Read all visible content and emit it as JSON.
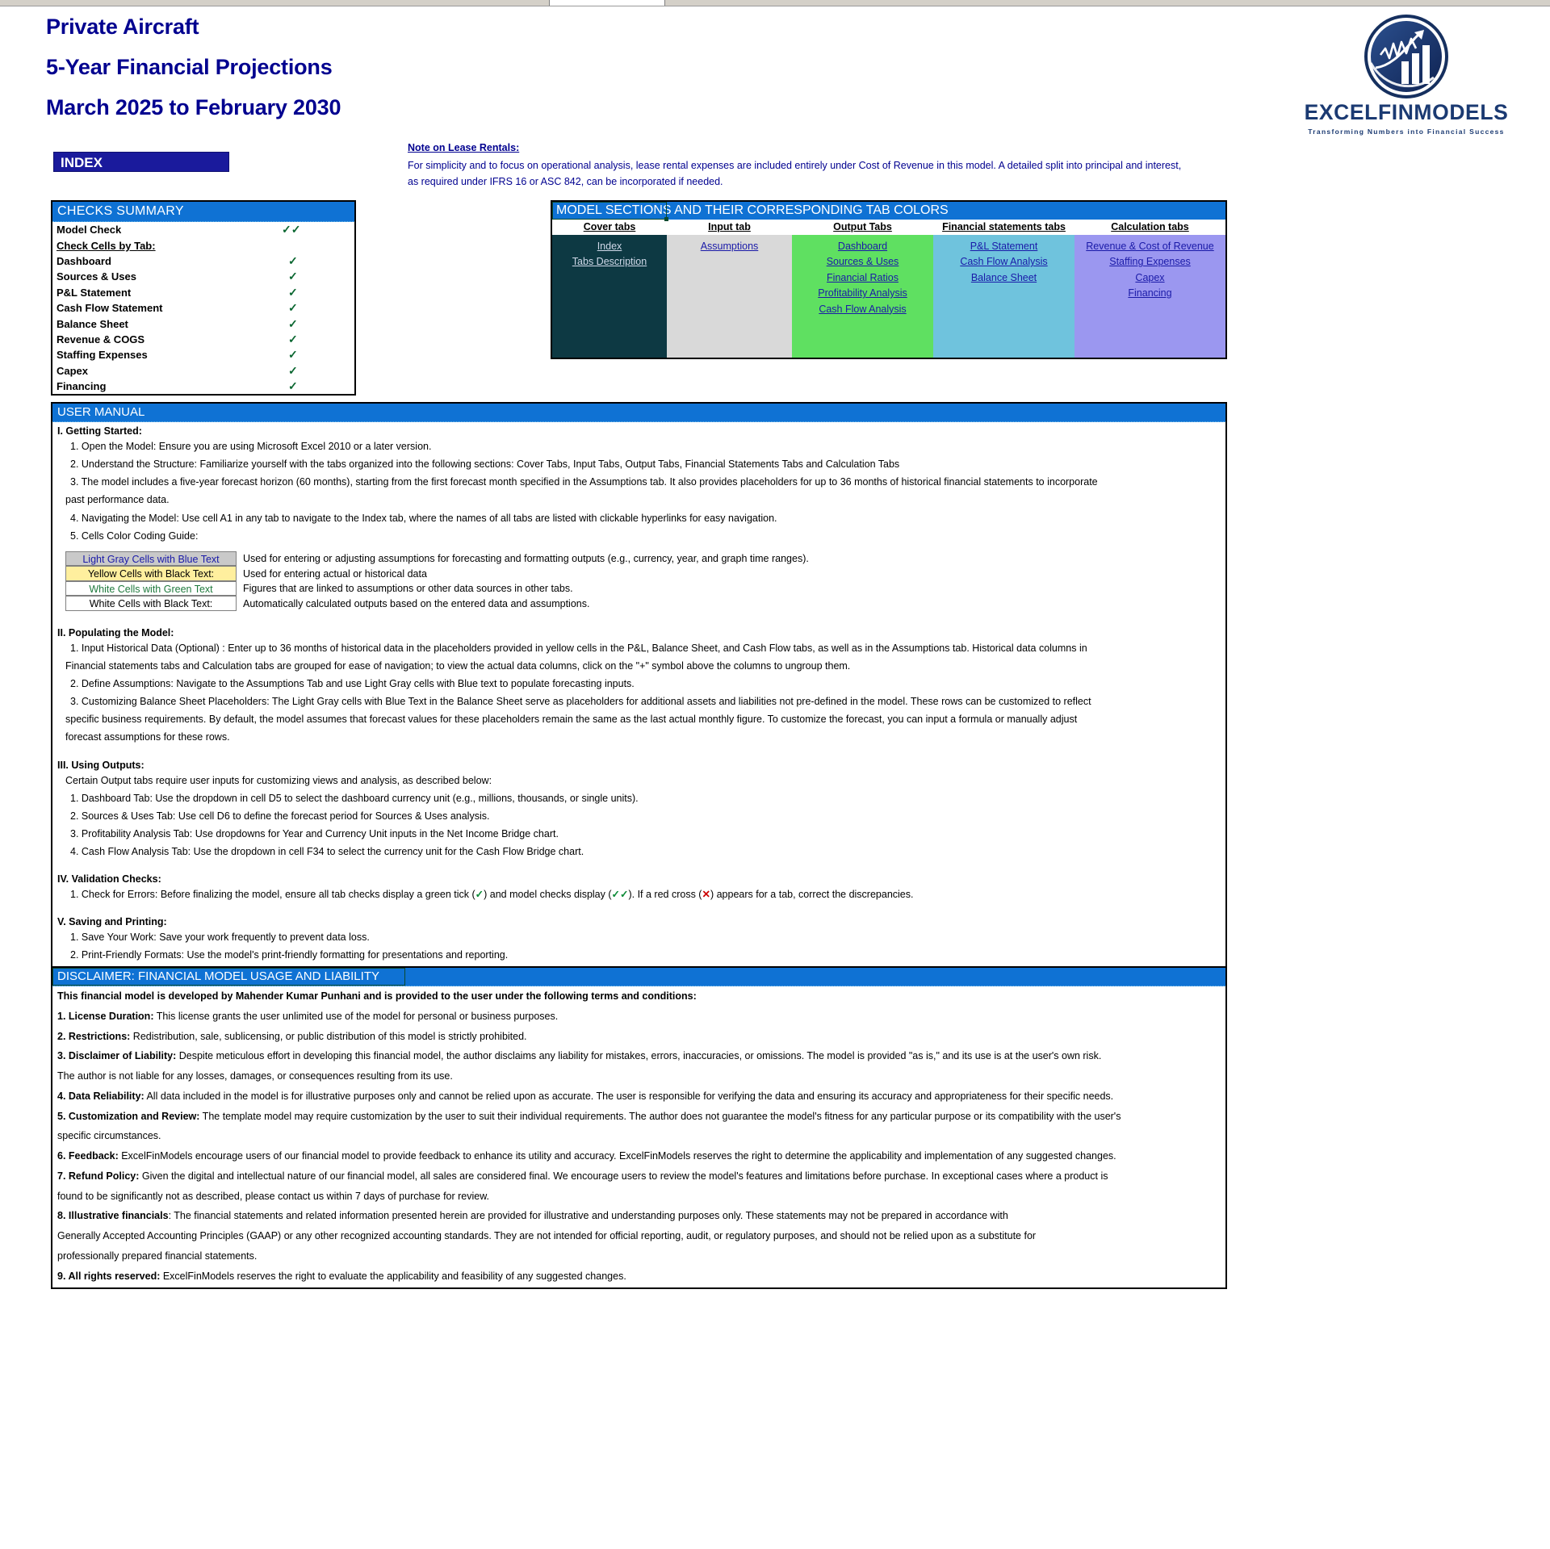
{
  "workbook": {
    "title_lines": [
      "Private Aircraft",
      "5-Year Financial Projections",
      "March 2025 to February 2030"
    ],
    "index_banner": "INDEX"
  },
  "logo": {
    "name": "EXCELFINMODELS",
    "tagline": "Transforming Numbers into Financial Success",
    "mark_icon": "chart-growth-circle-logo",
    "brand_color": "#1b3a72"
  },
  "lease_note": {
    "heading": "Note on Lease Rentals:",
    "body_line_1": "For simplicity and to focus on operational analysis, lease rental expenses are included entirely under Cost of Revenue in this model. A detailed split into principal and interest,",
    "body_line_2": "as required under IFRS 16 or ASC 842, can be incorporated if needed."
  },
  "checks_summary": {
    "header": "CHECKS  SUMMARY",
    "model_check": {
      "label": "Model Check",
      "mark": "✓✓"
    },
    "subhead": "Check Cells by Tab:",
    "rows": [
      {
        "label": "Dashboard",
        "mark": "✓"
      },
      {
        "label": "Sources & Uses",
        "mark": "✓"
      },
      {
        "label": "P&L Statement",
        "mark": "✓"
      },
      {
        "label": "Cash Flow Statement",
        "mark": "✓"
      },
      {
        "label": "Balance Sheet",
        "mark": "✓"
      },
      {
        "label": "Revenue & COGS",
        "mark": "✓"
      },
      {
        "label": "Staffing Expenses",
        "mark": "✓"
      },
      {
        "label": "Capex",
        "mark": "✓"
      },
      {
        "label": "Financing",
        "mark": "✓"
      }
    ]
  },
  "model_sections": {
    "header": "MODEL SECTIONS AND THEIR CORRESPONDING TAB COLORS",
    "columns": [
      {
        "header": "Cover tabs",
        "color": "#0d3943",
        "links": [
          "Index",
          "Tabs Description"
        ]
      },
      {
        "header": "Input tab",
        "color": "#d9d9d9",
        "links": [
          "Assumptions "
        ]
      },
      {
        "header": "Output Tabs",
        "color": "#5fe061",
        "links": [
          "Dashboard",
          "Sources & Uses",
          "Financial Ratios ",
          "Profitability Analysis",
          "Cash Flow Analysis"
        ]
      },
      {
        "header": "Financial statements tabs",
        "color": "#6fc3dd",
        "links": [
          "P&L Statement",
          "Cash Flow Analysis",
          "Balance Sheet"
        ]
      },
      {
        "header": "Calculation tabs",
        "color": "#9b97f0",
        "links": [
          "Revenue & Cost of Revenue",
          "Staffing Expenses",
          "Capex ",
          "Financing"
        ]
      }
    ]
  },
  "user_manual": {
    "header": "USER MANUAL",
    "section_1_title": "I. Getting Started:",
    "section_1_items": [
      "1. Open the Model: Ensure you are using Microsoft Excel 2010 or a later version.",
      "2. Understand the Structure: Familiarize yourself with the tabs organized into the following sections: Cover Tabs, Input Tabs, Output Tabs, Financial Statements Tabs and Calculation Tabs",
      "3. The model includes a five-year forecast horizon (60 months), starting from the first forecast month specified in the Assumptions tab. It also provides placeholders for up to 36 months of historical financial statements to incorporate",
      "past performance data.",
      "4. Navigating the Model: Use cell A1 in any tab to navigate to the Index tab, where the names of all tabs are listed with clickable hyperlinks for easy navigation.",
      "5. Cells Color Coding Guide:"
    ],
    "legend": [
      {
        "swatch": "Light Gray Cells with Blue Text",
        "desc": "Used for entering or adjusting assumptions for forecasting and formatting outputs (e.g., currency, year, and graph time ranges)."
      },
      {
        "swatch": "Yellow Cells with Black Text:",
        "desc": "Used for entering actual or historical data"
      },
      {
        "swatch": "White Cells with Green Text",
        "desc": "Figures that are linked to assumptions or other data sources in other tabs."
      },
      {
        "swatch": "White Cells with Black Text:",
        "desc": "Automatically calculated outputs based on the entered data and assumptions."
      }
    ],
    "section_2_title": "II. Populating the Model:",
    "section_2_items": [
      "1. Input Historical Data (Optional) : Enter up to 36 months of historical data in the placeholders provided in yellow cells in the P&L, Balance Sheet, and Cash Flow tabs, as well as in the Assumptions tab. Historical data columns in",
      "Financial statements tabs and Calculation tabs are grouped for ease of navigation; to view the actual data columns, click on the \"+\" symbol above the columns to ungroup them.",
      "2. Define Assumptions: Navigate to the Assumptions Tab and use Light Gray cells with Blue text to populate forecasting inputs.",
      "3. Customizing Balance Sheet Placeholders: The Light Gray cells with Blue Text in the Balance Sheet serve as placeholders for additional assets and liabilities not pre-defined in the model. These rows can be customized to reflect",
      "specific business requirements. By default, the model assumes that forecast values for these placeholders remain the same as the last actual monthly figure. To customize the forecast, you can input a formula or manually adjust",
      "forecast assumptions for these rows."
    ],
    "section_3_title": "III. Using Outputs:",
    "section_3_intro": "Certain Output tabs require user inputs for customizing views and analysis, as described below:",
    "section_3_items": [
      "1. Dashboard Tab: Use the dropdown in cell D5 to select the dashboard currency unit (e.g., millions, thousands, or single units).",
      "2. Sources & Uses Tab: Use cell D6 to define the forecast period for Sources & Uses analysis.",
      "3. Profitability Analysis Tab: Use dropdowns for Year and Currency Unit inputs in the Net Income Bridge chart.",
      "4. Cash Flow Analysis Tab: Use the dropdown in cell F34 to select the currency unit for the Cash Flow Bridge chart."
    ],
    "section_4_title": "IV. Validation Checks:",
    "section_4_item_parts": {
      "a": "1. Check for Errors:  Before finalizing the model, ensure all tab checks display a green tick (",
      "tick1": "✓",
      "b": ") and model checks display  (",
      "tick2": "✓✓",
      "c": "). If a red cross (",
      "cross": "✕",
      "d": ") appears for a tab, correct the discrepancies."
    },
    "section_5_title": "V. Saving and Printing:",
    "section_5_items": [
      "1. Save Your Work: Save your work frequently to prevent data loss.",
      "2. Print-Friendly Formats: Use the model's print-friendly formatting for presentations and reporting."
    ]
  },
  "disclaimer": {
    "header": "DISCLAIMER: FINANCIAL MODEL USAGE AND LIABILITY",
    "lead": "This financial model  is developed by Mahender Kumar Punhani and is provided to the user under the following terms and conditions:",
    "items": [
      {
        "num": "1. ",
        "term": "License Duration:",
        "text": " This license grants the user unlimited use of the model for personal or business purposes."
      },
      {
        "num": "2. ",
        "term": "Restrictions:",
        "text": " Redistribution, sale, sublicensing, or public distribution of this model is strictly prohibited."
      },
      {
        "num": "3. ",
        "term": "Disclaimer of Liability:",
        "text": " Despite meticulous effort in developing this financial model, the author disclaims any liability for mistakes, errors, inaccuracies, or omissions. The model is provided \"as is,\" and its use is at the user's own risk."
      },
      {
        "num": "",
        "term": "",
        "text": "The author is not liable for  any losses, damages, or consequences resulting from its use."
      },
      {
        "num": "4. ",
        "term": "Data Reliability:",
        "text": " All data included in the model is for illustrative purposes only and cannot be relied upon as accurate. The user is  responsible for verifying the data and ensuring its accuracy and appropriateness for their specific needs."
      },
      {
        "num": "5. ",
        "term": "Customization and Review:",
        "text": " The template model may require customization by the user to suit their individual requirements. The author does not guarantee the model's fitness for any  particular purpose or its compatibility with the user's"
      },
      {
        "num": "",
        "term": "",
        "text": "specific circumstances."
      },
      {
        "num": "6. ",
        "term": "Feedback:",
        "text": " ExcelFinModels encourage users of our financial model to provide feedback to enhance its utility and accuracy. ExcelFinModels reserves the right to determine the applicability and implementation of any suggested changes."
      },
      {
        "num": "7. ",
        "term": "Refund Policy:",
        "text": " Given the digital and intellectual nature of our financial model, all sales are considered final. We encourage users to review the model's features and limitations before purchase. In exceptional cases where a product is"
      },
      {
        "num": "",
        "term": "",
        "text": "found to be  significantly not as described, please contact us within 7 days of purchase for review."
      },
      {
        "num": "8. ",
        "term": "Illustrative financials",
        "text": ": The financial statements and related information presented herein are provided for illustrative and understanding purposes only. These statements may not be prepared in accordance with"
      },
      {
        "num": "",
        "term": "",
        "text": "Generally Accepted Accounting Principles (GAAP)  or any other  recognized accounting standards. They are not intended for official reporting, audit, or regulatory purposes, and should not be relied upon as a substitute for"
      },
      {
        "num": "",
        "term": "",
        "text": "professionally prepared financial statements."
      },
      {
        "num": "9. ",
        "term": "All rights reserved:",
        "text": " ExcelFinModels reserves the right to evaluate the applicability and feasibility of any suggested changes."
      }
    ]
  }
}
